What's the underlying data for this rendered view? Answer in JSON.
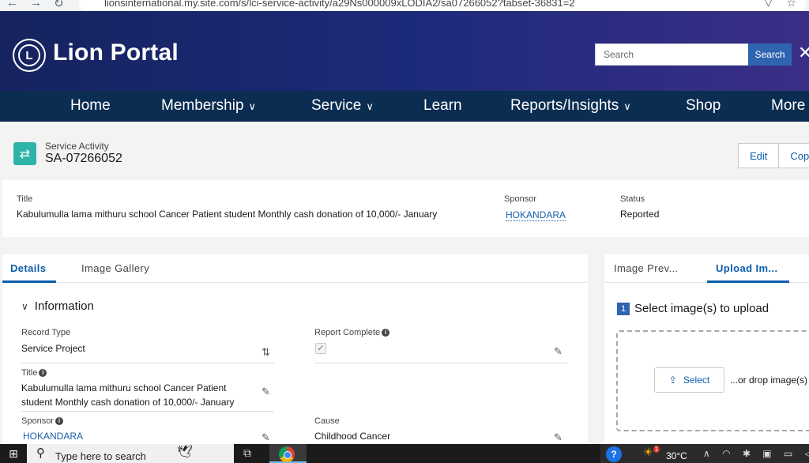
{
  "browser": {
    "url": "lionsinternational.my.site.com/s/lci-service-activity/a29Ns000009xLODIA2/sa07266052?tabset-36831=2"
  },
  "header": {
    "brand": "Lion Portal",
    "search_placeholder": "Search",
    "search_button": "Search"
  },
  "nav": {
    "items": [
      {
        "label": "Home"
      },
      {
        "label": "Membership"
      },
      {
        "label": "Service"
      },
      {
        "label": "Learn"
      },
      {
        "label": "Reports/Insights"
      },
      {
        "label": "Shop"
      },
      {
        "label": "More"
      }
    ]
  },
  "record": {
    "type": "Service Activity",
    "id": "SA-07266052",
    "buttons": [
      "Edit",
      "Copy"
    ]
  },
  "highlights": {
    "title_label": "Title",
    "title_value": "Kabulumulla lama mithuru school Cancer Patient student Monthly cash donation of 10,000/- January",
    "sponsor_label": "Sponsor",
    "sponsor_value": "HOKANDARA",
    "status_label": "Status",
    "status_value": "Reported"
  },
  "details": {
    "tabs": [
      "Details",
      "Image Gallery"
    ],
    "section_title": "Information",
    "fields": {
      "record_type_label": "Record Type",
      "record_type_value": "Service Project",
      "report_complete_label": "Report Complete",
      "title_label": "Title",
      "title_value_line1": "Kabulumulla lama mithuru school Cancer Patient",
      "title_value_line2": "student Monthly cash donation of 10,000/- January",
      "sponsor_label": "Sponsor",
      "sponsor_value": "HOKANDARA",
      "cause_label": "Cause",
      "cause_value": "Childhood Cancer"
    }
  },
  "upload": {
    "tabs": [
      "Image Prev...",
      "Upload Im..."
    ],
    "step_number": "1",
    "step_text": "Select image(s) to upload",
    "select_button": "Select",
    "drop_text": "...or drop image(s)"
  },
  "taskbar": {
    "search_placeholder": "Type here to search",
    "temperature": "30°C",
    "weather_badge": "1"
  },
  "colors": {
    "header_dark": "#16235f",
    "nav_bg": "#0c2d52",
    "accent": "#0b5cab",
    "search_button": "#2f64b0",
    "record_icon": "#2db4a8"
  }
}
